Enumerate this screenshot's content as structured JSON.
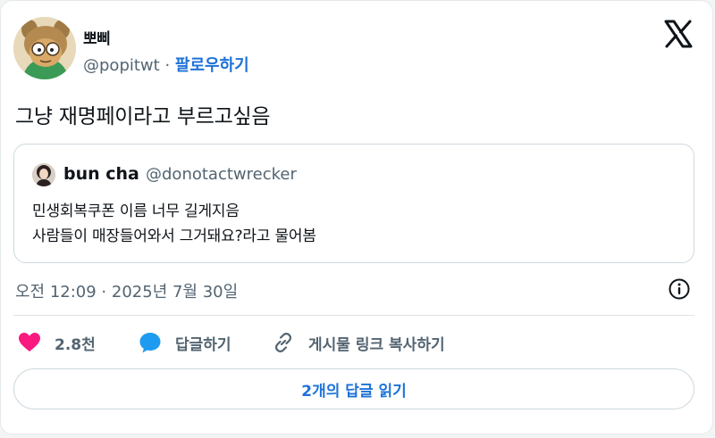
{
  "author": {
    "display_name": "뽀삐",
    "handle": "@popitwt",
    "separator": "·",
    "follow_label": "팔로우하기"
  },
  "tweet": {
    "text": "그냥 재명페이라고 부르고싶음"
  },
  "quoted": {
    "name": "bun cha",
    "handle": "@donotactwrecker",
    "lines": [
      "민생회복쿠폰 이름 너무 길게지음",
      "사람들이 매장들어와서 그거돼요?라고 물어봄"
    ]
  },
  "meta": {
    "timestamp": "오전 12:09 · 2025년 7월 30일"
  },
  "actions": {
    "like_count": "2.8천",
    "reply_label": "답글하기",
    "copy_link_label": "게시물 링크 복사하기"
  },
  "footer": {
    "read_replies_label": "2개의 답글 읽기"
  },
  "icons": {
    "logo": "x-logo-icon",
    "info": "info-icon",
    "like": "heart-icon",
    "reply": "reply-bubble-icon",
    "link": "link-icon"
  },
  "colors": {
    "accent": "#1d72d8",
    "heart": "#f91880",
    "muted": "#536471",
    "border": "#cfd9de"
  }
}
